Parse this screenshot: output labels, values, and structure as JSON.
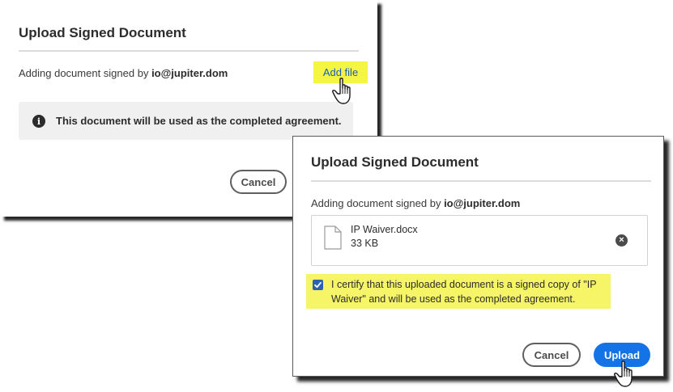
{
  "dialog_back": {
    "title": "Upload Signed Document",
    "signed_by_prefix": "Adding document signed by ",
    "signed_by_email": "io@jupiter.dom",
    "add_file_label": "Add file",
    "info_text": "This document will be used as the completed agreement.",
    "info_icon_glyph": "i",
    "cancel_label": "Cancel"
  },
  "dialog_front": {
    "title": "Upload Signed Document",
    "signed_by_prefix": "Adding document signed by ",
    "signed_by_email": "io@jupiter.dom",
    "file": {
      "name": "IP Waiver.docx",
      "size": "33 KB",
      "icon": "document-icon",
      "remove_icon": "close-circle-icon",
      "remove_glyph": "×"
    },
    "certify_checked": true,
    "certify_text": "I certify that this uploaded document is a signed copy of \"IP Waiver\" and will be used as the completed agreement.",
    "cancel_label": "Cancel",
    "upload_label": "Upload"
  },
  "colors": {
    "highlight": "#f5f544",
    "primary_blue": "#1473e6",
    "link_blue": "#1b5dbf",
    "checkbox_blue": "#2d62b0"
  }
}
